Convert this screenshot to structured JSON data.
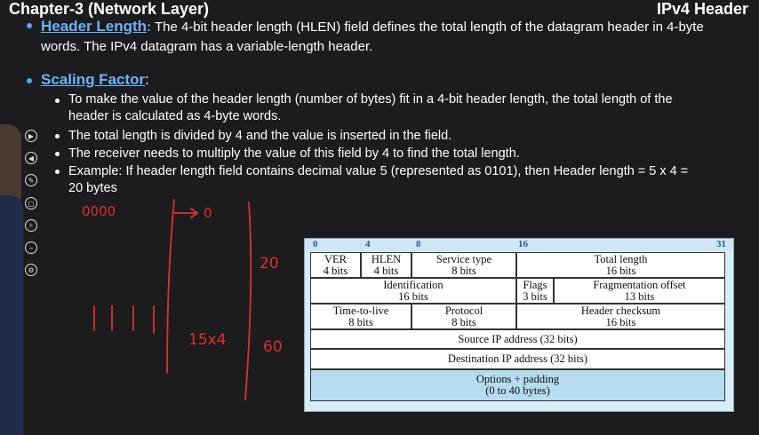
{
  "header": {
    "chapter": "Chapter-3 (Network Layer)",
    "title": "IPv4 Header"
  },
  "bullets": {
    "header_length": {
      "title": "Header Length",
      "colon": ":",
      "text_line1": "The 4-bit header length (HLEN) field defines the total length of the datagram header in 4-byte",
      "text_line2": "words. The IPv4 datagram has a variable-length header."
    },
    "scaling": {
      "title": "Scaling Factor",
      "colon": ":"
    },
    "sub": [
      {
        "line1": "To make the value of the header length (number of bytes) fit in a 4-bit header length, the total length of the",
        "line2": "header is calculated as 4-byte words."
      },
      {
        "line1": "The total length is divided by 4 and the value is inserted in the field.",
        "line2": ""
      },
      {
        "line1": "The receiver needs to multiply the value of this field by 4 to find the total length.",
        "line2": ""
      },
      {
        "line1": "Example: If header length field contains decimal value 5 (represented as 0101), then Header length = 5 x 4 =",
        "line2": "20 bytes"
      }
    ]
  },
  "diagram": {
    "ruler": [
      "0",
      "4",
      "8",
      "16",
      "31"
    ],
    "cells": {
      "ver": {
        "name": "VER",
        "bits": "4 bits"
      },
      "hlen": {
        "name": "HLEN",
        "bits": "4 bits"
      },
      "service": {
        "name": "Service type",
        "bits": "8 bits"
      },
      "total": {
        "name": "Total length",
        "bits": "16 bits"
      },
      "ident": {
        "name": "Identification",
        "bits": "16 bits"
      },
      "flags": {
        "name": "Flags",
        "bits": "3 bits"
      },
      "frag": {
        "name": "Fragmentation offset",
        "bits": "13 bits"
      },
      "ttl": {
        "name": "Time-to-live",
        "bits": "8 bits"
      },
      "proto": {
        "name": "Protocol",
        "bits": "8 bits"
      },
      "checksum": {
        "name": "Header checksum",
        "bits": "16 bits"
      },
      "src": {
        "name": "Source IP address (32 bits)"
      },
      "dst": {
        "name": "Destination IP address (32 bits)"
      },
      "opts": {
        "name": "Options + padding",
        "bits": "(0 to 40 bytes)"
      }
    }
  },
  "annotations": {
    "a1": "0000",
    "a2": "0",
    "a3": "20",
    "a4": "1111",
    "a5": "15x4",
    "a6": "60"
  },
  "colors": {
    "heading": "#69b3ff",
    "background": "#1c1c1e",
    "handwriting": "#e0302a"
  }
}
